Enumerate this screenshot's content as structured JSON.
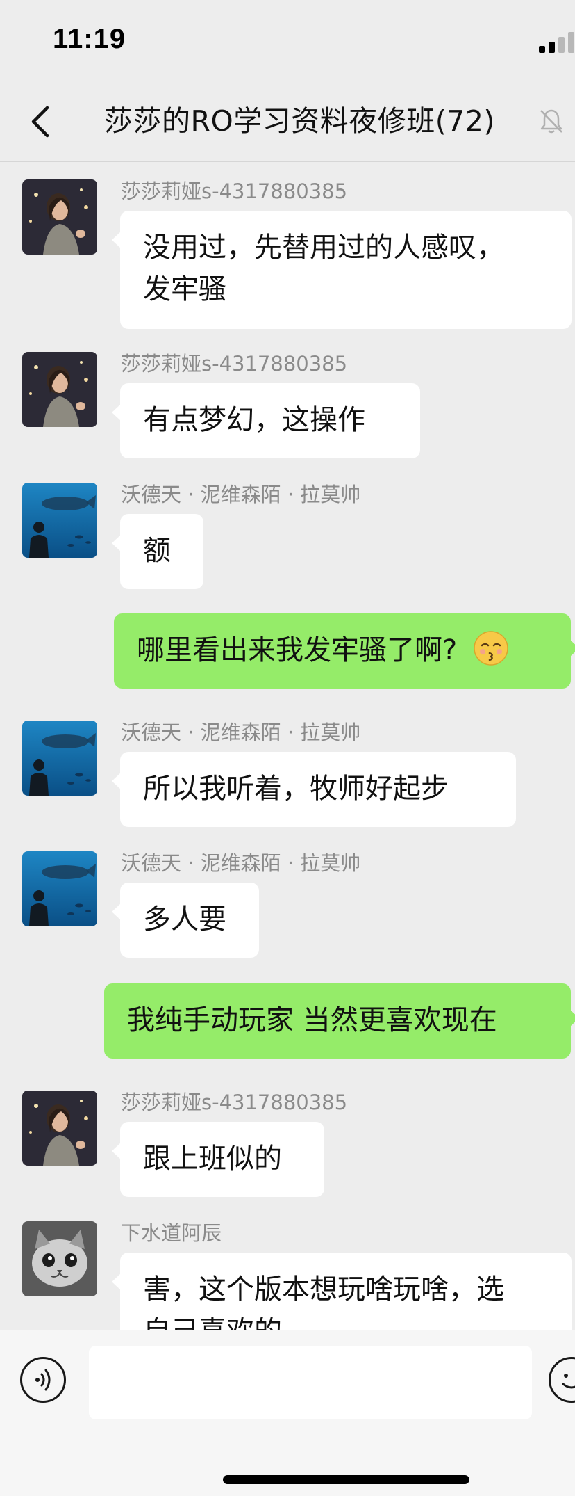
{
  "status_bar": {
    "time": "11:19"
  },
  "header": {
    "title": "莎莎的RO学习资料夜修班(72)"
  },
  "messages": [
    {
      "sender": "莎莎莉娅s-4317880385",
      "text_lines": [
        "没用过，先替用过的人感叹，",
        "发牢骚"
      ],
      "direction": "in",
      "avatar": "woman-photo"
    },
    {
      "sender": "莎莎莉娅s-4317880385",
      "text": "有点梦幻，这操作",
      "direction": "in",
      "avatar": "woman-photo"
    },
    {
      "sender": "沃德天 · 泥维森陌 · 拉莫帅",
      "text": "额",
      "direction": "in",
      "avatar": "aquarium-photo"
    },
    {
      "text": "哪里看出来我发牢骚了啊?",
      "emoji": "😚",
      "direction": "out"
    },
    {
      "sender": "沃德天 · 泥维森陌 · 拉莫帅",
      "text": "所以我听着，牧师好起步",
      "direction": "in",
      "avatar": "aquarium-photo"
    },
    {
      "sender": "沃德天 · 泥维森陌 · 拉莫帅",
      "text": "多人要",
      "direction": "in",
      "avatar": "aquarium-photo"
    },
    {
      "text": "我纯手动玩家 当然更喜欢现在",
      "direction": "out"
    },
    {
      "sender": "莎莎莉娅s-4317880385",
      "text": "跟上班似的",
      "direction": "in",
      "avatar": "woman-photo"
    },
    {
      "sender": "下水道阿辰",
      "text_lines": [
        "害，这个版本想玩啥玩啥，选",
        "自己喜欢的"
      ],
      "direction": "in",
      "avatar": "cat-photo"
    }
  ],
  "input_bar": {
    "voice_icon": "voice-icon",
    "emoji_icon": "emoji-icon"
  },
  "colors": {
    "background": "#ededed",
    "outgoing_bubble": "#95ec69",
    "incoming_bubble": "#ffffff",
    "sender_name": "#8a8a8a"
  }
}
